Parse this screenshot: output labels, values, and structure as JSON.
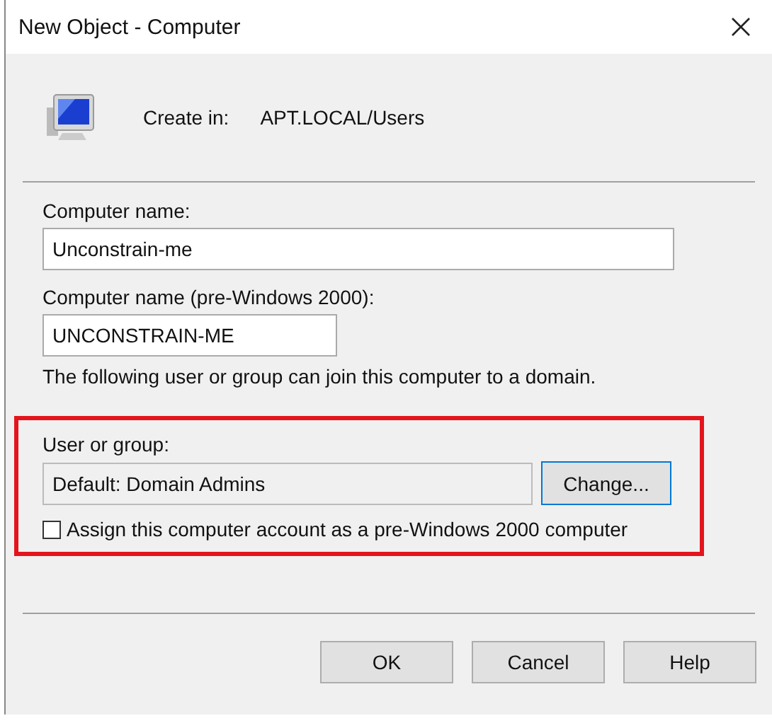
{
  "window": {
    "title": "New Object - Computer"
  },
  "create_in": {
    "label": "Create in:",
    "value": "APT.LOCAL/Users"
  },
  "computer_name": {
    "label": "Computer name:",
    "value": "Unconstrain-me"
  },
  "computer_name_pre2000": {
    "label": "Computer name (pre-Windows 2000):",
    "value": "UNCONSTRAIN-ME"
  },
  "join_note": "The following user or group can join this computer to a domain.",
  "user_or_group": {
    "label": "User or group:",
    "value": "Default: Domain Admins",
    "disabled": true,
    "button": "Change..."
  },
  "pre2000_checkbox": {
    "label": "Assign this computer account as a pre-Windows 2000 computer",
    "checked": false
  },
  "buttons": [
    "OK",
    "Cancel",
    "Help"
  ]
}
